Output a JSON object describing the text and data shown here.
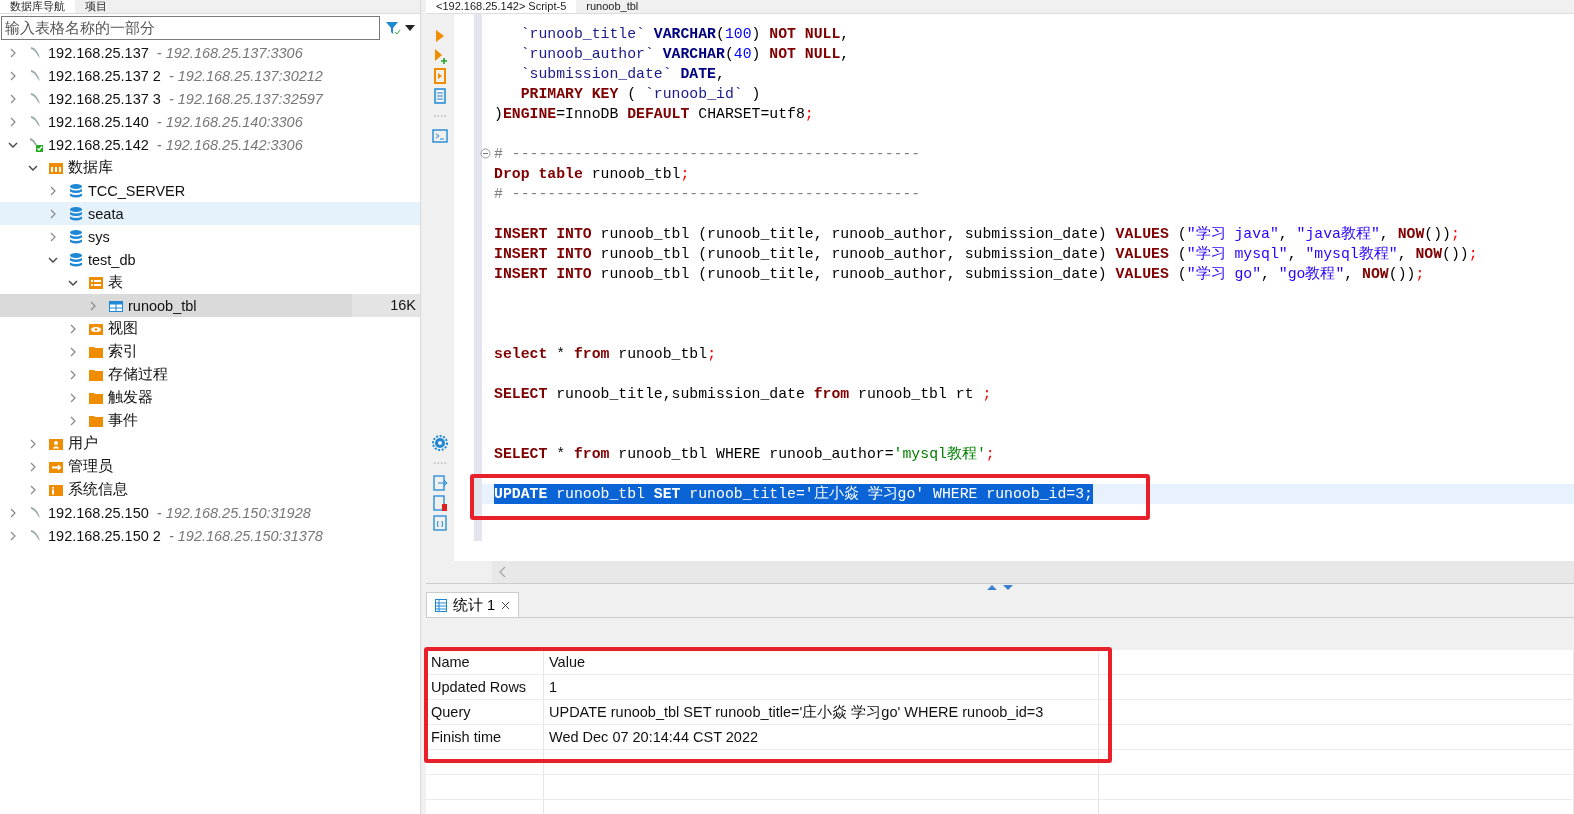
{
  "navigator": {
    "tabs": [
      {
        "label": "数据库导航",
        "selected": true
      },
      {
        "label": "项目",
        "selected": false
      }
    ],
    "filter": {
      "placeholder": "输入表格名称的一部分"
    },
    "tree": [
      {
        "kind": "connection",
        "label": "192.168.25.137",
        "address": "- 192.168.25.137:3306",
        "expanded": false,
        "selected": false,
        "hovered": false
      },
      {
        "kind": "connection",
        "label": "192.168.25.137 2",
        "address": "- 192.168.25.137:30212",
        "expanded": false,
        "selected": false,
        "hovered": false
      },
      {
        "kind": "connection",
        "label": "192.168.25.137 3",
        "address": "- 192.168.25.137:32597",
        "expanded": false,
        "selected": false,
        "hovered": false
      },
      {
        "kind": "connection",
        "label": "192.168.25.140",
        "address": "- 192.168.25.140:3306",
        "expanded": false,
        "selected": false,
        "hovered": false
      },
      {
        "kind": "connection-active",
        "label": "192.168.25.142",
        "address": "- 192.168.25.142:3306",
        "expanded": true,
        "selected": false,
        "hovered": false,
        "children": [
          {
            "kind": "databases",
            "label": "数据库",
            "expanded": true,
            "selected": false,
            "hovered": false,
            "children": [
              {
                "kind": "database",
                "label": "TCC_SERVER",
                "expanded": false,
                "selected": false,
                "hovered": false
              },
              {
                "kind": "database",
                "label": "seata",
                "expanded": false,
                "selected": false,
                "hovered": true
              },
              {
                "kind": "database",
                "label": "sys",
                "expanded": false,
                "selected": false,
                "hovered": false
              },
              {
                "kind": "database",
                "label": "test_db",
                "expanded": true,
                "selected": false,
                "hovered": false,
                "children": [
                  {
                    "kind": "tables",
                    "label": "表",
                    "expanded": true,
                    "selected": false,
                    "hovered": false,
                    "children": [
                      {
                        "kind": "table",
                        "label": "runoob_tbl",
                        "size": "16K",
                        "expanded": false,
                        "selected": true,
                        "hovered": false
                      }
                    ]
                  },
                  {
                    "kind": "views",
                    "label": "视图",
                    "expanded": false,
                    "selected": false,
                    "hovered": false
                  },
                  {
                    "kind": "folder",
                    "label": "索引",
                    "expanded": false,
                    "selected": false,
                    "hovered": false
                  },
                  {
                    "kind": "folder",
                    "label": "存储过程",
                    "expanded": false,
                    "selected": false,
                    "hovered": false
                  },
                  {
                    "kind": "folder",
                    "label": "触发器",
                    "expanded": false,
                    "selected": false,
                    "hovered": false
                  },
                  {
                    "kind": "folder",
                    "label": "事件",
                    "expanded": false,
                    "selected": false,
                    "hovered": false
                  }
                ]
              }
            ]
          },
          {
            "kind": "users",
            "label": "用户",
            "expanded": false,
            "selected": false,
            "hovered": false
          },
          {
            "kind": "admin",
            "label": "管理员",
            "expanded": false,
            "selected": false,
            "hovered": false
          },
          {
            "kind": "info",
            "label": "系统信息",
            "expanded": false,
            "selected": false,
            "hovered": false
          }
        ]
      },
      {
        "kind": "connection",
        "label": "192.168.25.150",
        "address": "- 192.168.25.150:31928",
        "expanded": false,
        "selected": false,
        "hovered": false
      },
      {
        "kind": "connection",
        "label": "192.168.25.150 2",
        "address": "- 192.168.25.150:31378",
        "expanded": false,
        "selected": false,
        "hovered": false
      }
    ]
  },
  "editor": {
    "tabs": [
      {
        "label": "<192.168.25.142> Script-5",
        "selected": true
      },
      {
        "label": "runoob_tbl",
        "selected": false
      }
    ],
    "lines": [
      {
        "kind": "code",
        "selected": false,
        "marked": false,
        "tokens": [
          {
            "kind": "identifier",
            "text": "   `runoob_title`"
          },
          {
            "kind": "type",
            "text": " VARCHAR"
          },
          {
            "kind": "plain",
            "text": "("
          },
          {
            "kind": "number",
            "text": "100"
          },
          {
            "kind": "plain",
            "text": ") "
          },
          {
            "kind": "keyword",
            "text": "NOT NULL"
          },
          {
            "kind": "plain",
            "text": ","
          }
        ]
      },
      {
        "kind": "code",
        "selected": false,
        "marked": false,
        "tokens": [
          {
            "kind": "identifier",
            "text": "   `runoob_author`"
          },
          {
            "kind": "type",
            "text": " VARCHAR"
          },
          {
            "kind": "plain",
            "text": "("
          },
          {
            "kind": "number",
            "text": "40"
          },
          {
            "kind": "plain",
            "text": ") "
          },
          {
            "kind": "keyword",
            "text": "NOT NULL"
          },
          {
            "kind": "plain",
            "text": ","
          }
        ]
      },
      {
        "kind": "code",
        "selected": false,
        "marked": false,
        "tokens": [
          {
            "kind": "identifier",
            "text": "   `submission_date`"
          },
          {
            "kind": "type",
            "text": " DATE"
          },
          {
            "kind": "plain",
            "text": ","
          }
        ]
      },
      {
        "kind": "code",
        "selected": false,
        "marked": false,
        "tokens": [
          {
            "kind": "keyword",
            "text": "   PRIMARY KEY"
          },
          {
            "kind": "plain",
            "text": " ( "
          },
          {
            "kind": "identifier",
            "text": "`runoob_id`"
          },
          {
            "kind": "plain",
            "text": " )"
          }
        ]
      },
      {
        "kind": "code",
        "selected": false,
        "marked": false,
        "tokens": [
          {
            "kind": "plain",
            "text": ")"
          },
          {
            "kind": "keyword",
            "text": "ENGINE"
          },
          {
            "kind": "plain",
            "text": "=InnoDB "
          },
          {
            "kind": "keyword",
            "text": "DEFAULT"
          },
          {
            "kind": "plain",
            "text": " CHARSET=utf8"
          },
          {
            "kind": "semicolon",
            "text": ";"
          }
        ]
      },
      {
        "kind": "blank",
        "selected": false,
        "marked": false
      },
      {
        "kind": "fold",
        "selected": false,
        "marked": false,
        "tokens": [
          {
            "kind": "comment",
            "text": "# ----------------------------------------------"
          }
        ]
      },
      {
        "kind": "code",
        "selected": false,
        "marked": false,
        "tokens": [
          {
            "kind": "keyword",
            "text": "Drop table"
          },
          {
            "kind": "plain",
            "text": " runoob_tbl"
          },
          {
            "kind": "semicolon",
            "text": ";"
          }
        ]
      },
      {
        "kind": "code",
        "selected": false,
        "marked": false,
        "tokens": [
          {
            "kind": "comment",
            "text": "# ----------------------------------------------"
          }
        ]
      },
      {
        "kind": "blank",
        "selected": false,
        "marked": false
      },
      {
        "kind": "code",
        "selected": false,
        "marked": false,
        "tokens": [
          {
            "kind": "keyword",
            "text": "INSERT INTO"
          },
          {
            "kind": "plain",
            "text": " runoob_tbl (runoob_title, runoob_author, submission_date) "
          },
          {
            "kind": "keyword",
            "text": "VALUES"
          },
          {
            "kind": "plain",
            "text": " ("
          },
          {
            "kind": "string",
            "text": "\"学习 java\""
          },
          {
            "kind": "plain",
            "text": ", "
          },
          {
            "kind": "string",
            "text": "\"java教程\""
          },
          {
            "kind": "plain",
            "text": ", "
          },
          {
            "kind": "keyword",
            "text": "NOW"
          },
          {
            "kind": "plain",
            "text": "())"
          },
          {
            "kind": "semicolon",
            "text": ";"
          }
        ]
      },
      {
        "kind": "code",
        "selected": false,
        "marked": false,
        "tokens": [
          {
            "kind": "keyword",
            "text": "INSERT INTO"
          },
          {
            "kind": "plain",
            "text": " runoob_tbl (runoob_title, runoob_author, submission_date) "
          },
          {
            "kind": "keyword",
            "text": "VALUES"
          },
          {
            "kind": "plain",
            "text": " ("
          },
          {
            "kind": "string",
            "text": "\"学习 mysql\""
          },
          {
            "kind": "plain",
            "text": ", "
          },
          {
            "kind": "string",
            "text": "\"mysql教程\""
          },
          {
            "kind": "plain",
            "text": ", "
          },
          {
            "kind": "keyword",
            "text": "NOW"
          },
          {
            "kind": "plain",
            "text": "())"
          },
          {
            "kind": "semicolon",
            "text": ";"
          }
        ]
      },
      {
        "kind": "code",
        "selected": false,
        "marked": false,
        "tokens": [
          {
            "kind": "keyword",
            "text": "INSERT INTO"
          },
          {
            "kind": "plain",
            "text": " runoob_tbl (runoob_title, runoob_author, submission_date) "
          },
          {
            "kind": "keyword",
            "text": "VALUES"
          },
          {
            "kind": "plain",
            "text": " ("
          },
          {
            "kind": "string",
            "text": "\"学习 go\""
          },
          {
            "kind": "plain",
            "text": ", "
          },
          {
            "kind": "string",
            "text": "\"go教程\""
          },
          {
            "kind": "plain",
            "text": ", "
          },
          {
            "kind": "keyword",
            "text": "NOW"
          },
          {
            "kind": "plain",
            "text": "())"
          },
          {
            "kind": "semicolon",
            "text": ";"
          }
        ]
      },
      {
        "kind": "blank",
        "selected": false,
        "marked": false
      },
      {
        "kind": "blank",
        "selected": false,
        "marked": false
      },
      {
        "kind": "blank",
        "selected": false,
        "marked": false
      },
      {
        "kind": "code",
        "selected": false,
        "marked": false,
        "tokens": [
          {
            "kind": "keyword",
            "text": "select"
          },
          {
            "kind": "plain",
            "text": " * "
          },
          {
            "kind": "keyword",
            "text": "from"
          },
          {
            "kind": "plain",
            "text": " runoob_tbl"
          },
          {
            "kind": "semicolon",
            "text": ";"
          }
        ]
      },
      {
        "kind": "blank",
        "selected": false,
        "marked": false
      },
      {
        "kind": "code",
        "selected": false,
        "marked": false,
        "tokens": [
          {
            "kind": "keyword",
            "text": "SELECT"
          },
          {
            "kind": "plain",
            "text": " runoob_title,submission_date "
          },
          {
            "kind": "keyword",
            "text": "from"
          },
          {
            "kind": "plain",
            "text": " runoob_tbl rt "
          },
          {
            "kind": "semicolon",
            "text": ";"
          }
        ]
      },
      {
        "kind": "blank",
        "selected": false,
        "marked": false
      },
      {
        "kind": "blank",
        "selected": false,
        "marked": false
      },
      {
        "kind": "code",
        "selected": false,
        "marked": false,
        "tokens": [
          {
            "kind": "keyword",
            "text": "SELECT"
          },
          {
            "kind": "plain",
            "text": " * "
          },
          {
            "kind": "keyword",
            "text": "from"
          },
          {
            "kind": "plain",
            "text": " runoob_tbl WHERE runoob_author="
          },
          {
            "kind": "quoted",
            "text": "'mysql教程'"
          },
          {
            "kind": "semicolon",
            "text": ";"
          }
        ]
      },
      {
        "kind": "blank",
        "selected": false,
        "marked": false
      },
      {
        "kind": "code",
        "selected": true,
        "marked": true,
        "tokens": [
          {
            "kind": "keyword",
            "text": "UPDATE"
          },
          {
            "kind": "plain",
            "text": " runoob_tbl "
          },
          {
            "kind": "keyword",
            "text": "SET"
          },
          {
            "kind": "plain",
            "text": " runoob_title='庄小焱 学习go' WHERE runoob_id=3;"
          }
        ]
      }
    ]
  },
  "results": {
    "tabs": [
      {
        "label": "统计 1",
        "selected": true
      }
    ],
    "marked": true,
    "columns": [
      "Name",
      "Value"
    ],
    "rows": [
      {
        "name": "Updated Rows",
        "value": "1"
      },
      {
        "name": "Query",
        "value": "UPDATE runoob_tbl SET runoob_title='庄小焱 学习go' WHERE runoob_id=3"
      },
      {
        "name": "Finish time",
        "value": "Wed Dec 07 20:14:44 CST 2022"
      }
    ]
  }
}
